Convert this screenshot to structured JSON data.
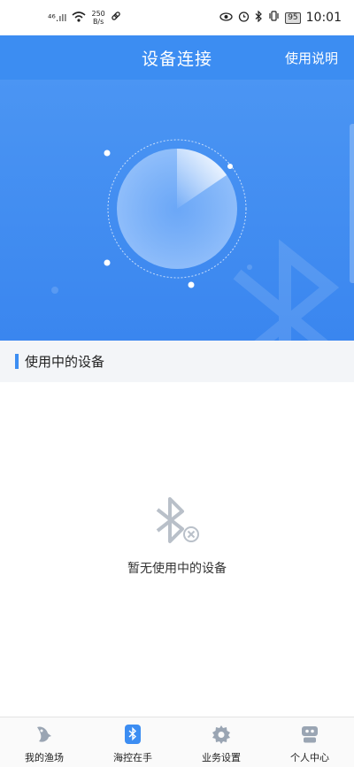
{
  "status_bar": {
    "signal": "⁴⁶.ıll",
    "net_speed_value": "250",
    "net_speed_unit": "B/s",
    "battery": "95",
    "time": "10:01"
  },
  "header": {
    "title": "设备连接",
    "help": "使用说明"
  },
  "section": {
    "title": "使用中的设备"
  },
  "empty_state": {
    "icon": "bluetooth-disabled-icon",
    "text": "暂无使用中的设备"
  },
  "bottom_nav": {
    "items": [
      {
        "label": "我的渔场",
        "icon": "fish-icon",
        "active": false
      },
      {
        "label": "海控在手",
        "icon": "bluetooth-icon",
        "active": true
      },
      {
        "label": "业务设置",
        "icon": "gear-icon",
        "active": false
      },
      {
        "label": "个人中心",
        "icon": "robot-icon",
        "active": false
      }
    ]
  },
  "colors": {
    "accent": "#3c8df2",
    "icon_gray": "#9aa5b3"
  }
}
